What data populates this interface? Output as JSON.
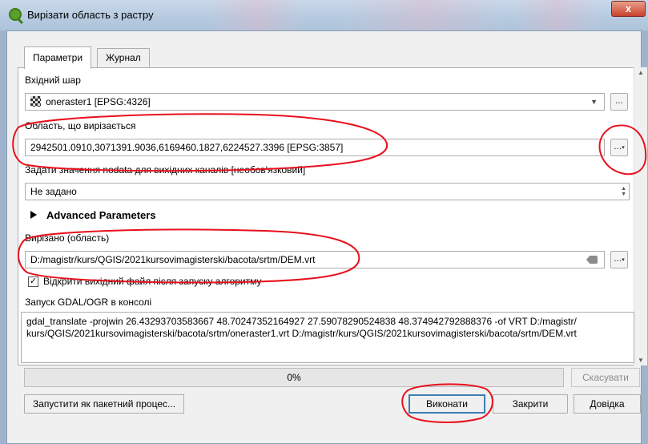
{
  "window": {
    "title": "Вирізати область з растру",
    "close_label": "x"
  },
  "tabs": [
    {
      "label": "Параметри",
      "active": true
    },
    {
      "label": "Журнал",
      "active": false
    }
  ],
  "params": {
    "input_layer": {
      "label": "Вхідний шар",
      "value": "oneraster1 [EPSG:4326]",
      "button": "..."
    },
    "extent": {
      "label": "Область, що вирізається",
      "value": "2942501.0910,3071391.9036,6169460.1827,6224527.3396 [EPSG:3857]",
      "button": "..."
    },
    "nodata": {
      "label": "Задати значення nodata для вихідних каналів [необов'язковий]",
      "value": "Не задано"
    },
    "advanced": {
      "label": "Advanced Parameters"
    },
    "output": {
      "label": "Вирізано (область)",
      "value": "D:/magistr/kurs/QGIS/2021kursovimagisterski/bacota/srtm/DEM.vrt",
      "button": "..."
    },
    "open_after": {
      "label": "Відкрити вихідний файл після запуску алгоритму",
      "checked": true
    },
    "console": {
      "label": "Запуск GDAL/OGR в консолі",
      "line1": "gdal_translate -projwin 26.43293703583667 48.70247352164927 27.59078290524838 48.374942792888376 -of VRT D:/magistr/",
      "line2": "kurs/QGIS/2021kursovimagisterski/bacota/srtm/oneraster1.vrt D:/magistr/kurs/QGIS/2021kursovimagisterski/bacota/srtm/DEM.vrt"
    }
  },
  "progress": {
    "value": 0,
    "text": "0%"
  },
  "buttons": {
    "cancel": "Скасувати",
    "batch": "Запустити як пакетний процес...",
    "run": "Виконати",
    "close": "Закрити",
    "help": "Довідка"
  },
  "colors": {
    "annotation": "#e8101c",
    "default_button_border": "#3c7fb1"
  }
}
